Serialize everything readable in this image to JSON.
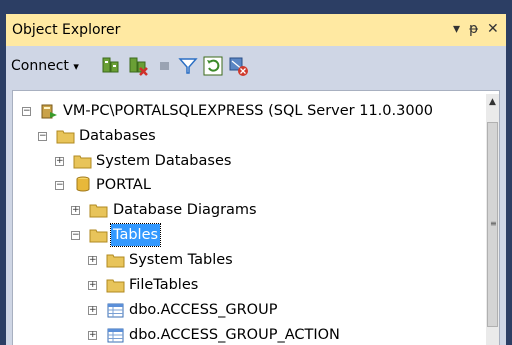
{
  "panel": {
    "title": "Object Explorer",
    "controls": {
      "menu": "▾",
      "pin": "ᵽ",
      "close": "✕"
    }
  },
  "toolbar": {
    "connect_label": "Connect",
    "connect_arrow": "▾",
    "icons": [
      "connect-object-explorer-icon",
      "disconnect-icon",
      "stop-icon",
      "filter-icon",
      "refresh-icon",
      "start-powershell-icon"
    ]
  },
  "tree": {
    "server": "VM-PC\\PORTALSQLEXPRESS (SQL Server 11.0.3000",
    "databases": "Databases",
    "system_databases": "System Databases",
    "portal": "PORTAL",
    "database_diagrams": "Database Diagrams",
    "tables": "Tables",
    "system_tables": "System Tables",
    "file_tables": "FileTables",
    "access_group": "dbo.ACCESS_GROUP",
    "access_group_action": "dbo.ACCESS_GROUP_ACTION"
  },
  "colors": {
    "title_bar": "#ffe9a2",
    "toolbar": "#cfd6e5",
    "selection": "#3399ff",
    "folder": "#e8c45a"
  }
}
